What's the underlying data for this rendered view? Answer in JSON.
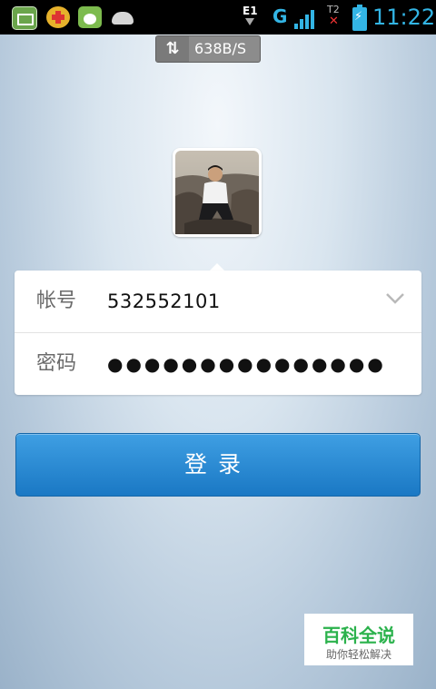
{
  "status_bar": {
    "network_label": "E1",
    "carrier_label": "G",
    "sim_label": "T2",
    "time": "11:22",
    "icons": [
      "battery-app-icon",
      "plus-app-icon",
      "rabbit-app-icon",
      "android-icon",
      "data-arrow-icon",
      "signal-icon",
      "no-signal-icon",
      "battery-charging-icon"
    ]
  },
  "speed_indicator": {
    "icon": "up-down-arrows-icon",
    "value": "638B/S"
  },
  "login_form": {
    "account_label": "帐号",
    "account_value": "532552101",
    "password_label": "密码",
    "password_value": "●●●●●●●●●●●●●●●"
  },
  "login_button": {
    "label": "登录"
  },
  "watermark": {
    "title": "百科全说",
    "subtitle": "助你轻松解决"
  },
  "colors": {
    "accent": "#33b5e5",
    "button": "#1a78c4",
    "watermark_green": "#2bb24c"
  }
}
